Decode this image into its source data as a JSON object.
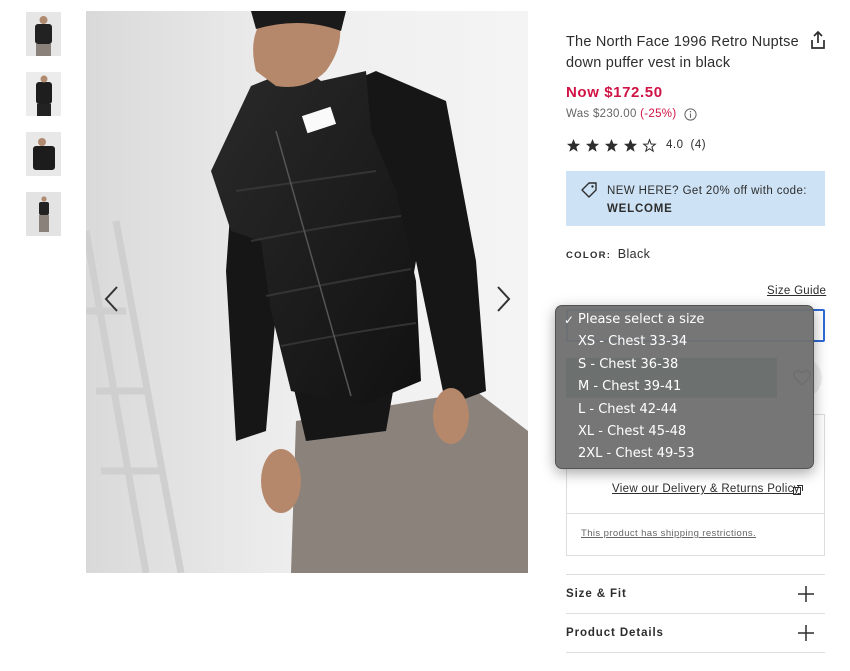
{
  "product": {
    "title": "The North Face 1996 Retro Nuptse down puffer vest in black",
    "price_now": "Now $172.50",
    "price_was": "Was $230.00",
    "discount": "(-25%)",
    "rating_text": "4.0",
    "review_count": "(4)",
    "rating_value": 4,
    "rating_max": 5
  },
  "promo": {
    "line1": "NEW HERE? Get 20% off with code:",
    "code": "WELCOME"
  },
  "color": {
    "label": "COLOR:",
    "value": "Black"
  },
  "size": {
    "guide_label": "Size Guide",
    "options": [
      {
        "label": "Please select a size",
        "selected": true
      },
      {
        "label": "XS - Chest 33-34",
        "selected": false
      },
      {
        "label": "S - Chest 36-38",
        "selected": false
      },
      {
        "label": "M - Chest 39-41",
        "selected": false
      },
      {
        "label": "L - Chest 42-44",
        "selected": false
      },
      {
        "label": "XL - Chest 45-48",
        "selected": false
      },
      {
        "label": "2XL - Chest 49-53",
        "selected": false
      }
    ]
  },
  "delivery": {
    "policy_link": "View our Delivery & Returns Policy",
    "restrictions": "This product has shipping restrictions."
  },
  "accordions": [
    {
      "label": "Size & Fit"
    },
    {
      "label": "Product Details"
    }
  ],
  "icons": {
    "share": "share-icon",
    "info": "info-icon",
    "tag": "tag-icon",
    "prev": "chevron-left-icon",
    "next": "chevron-right-icon",
    "heart": "heart-icon",
    "external": "external-link-icon",
    "plus": "plus-icon"
  },
  "colors": {
    "sale_red": "#d01345",
    "promo_blue": "#cde2f5",
    "add_green": "#018849",
    "focus_blue": "#2d6ad4"
  }
}
